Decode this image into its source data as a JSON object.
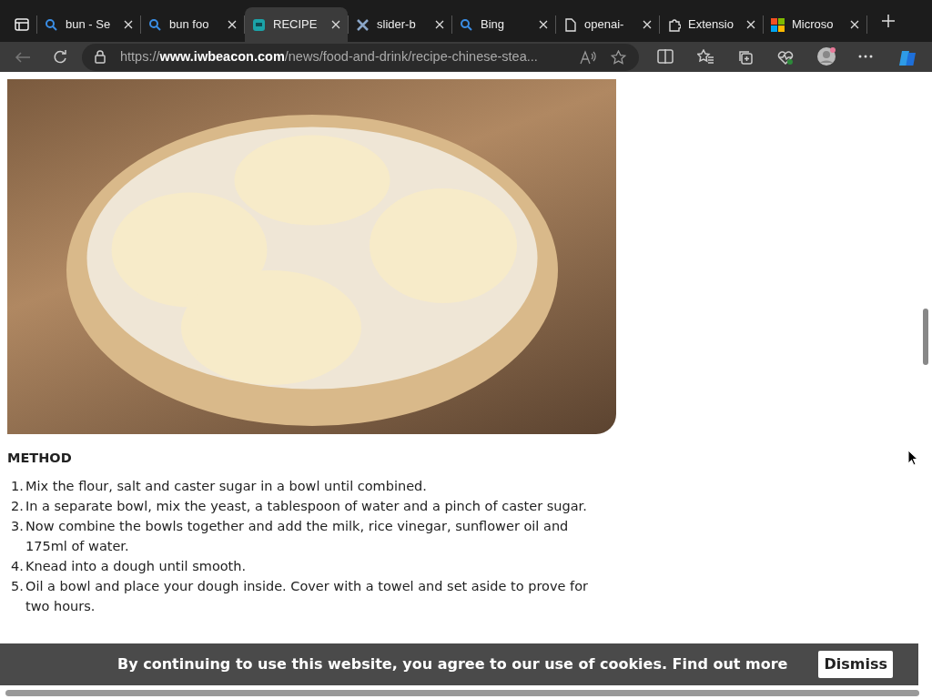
{
  "tabs": [
    {
      "label": "bun - Se",
      "selected": false
    },
    {
      "label": "bun foo",
      "selected": false
    },
    {
      "label": "RECIPE",
      "selected": true
    },
    {
      "label": "slider-b",
      "selected": false
    },
    {
      "label": "Bing",
      "selected": false
    },
    {
      "label": "openai-",
      "selected": false
    },
    {
      "label": "Extensio",
      "selected": false
    },
    {
      "label": "Microso",
      "selected": false
    }
  ],
  "address": {
    "url": "https://**www.iwbeacon.com**/news/food-and-drink/recipe-chinese-stea..."
  },
  "article": {
    "heading": "METHOD",
    "steps": [
      {
        "number": "1.",
        "text": "Mix the flour, salt and caster sugar in a bowl until combined."
      },
      {
        "number": "2.",
        "text": "In a separate bowl, mix the yeast, a tablespoon of water and a pinch of caster sugar."
      },
      {
        "number": "3.",
        "text": "Now combine the bowls together and add the milk, rice vinegar, sunflower oil and 175ml of water."
      },
      {
        "number": "4.",
        "text": "Knead into a dough until smooth."
      },
      {
        "number": "5.",
        "text": "Oil a bowl and place your dough inside. Cover with a towel and set aside to prove for two hours."
      }
    ]
  },
  "cookie_banner": {
    "message": "By continuing to use this website, you agree to our use of cookies.",
    "link": "Find out more",
    "button": "Dismiss"
  }
}
